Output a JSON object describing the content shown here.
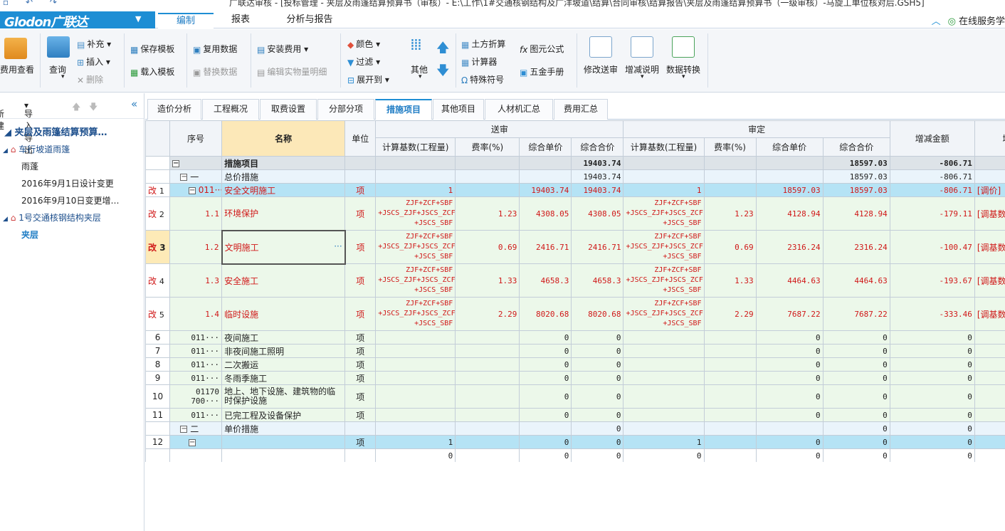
{
  "app": {
    "title": "广联达审核 - [投标管理 - 夹层及雨篷结算预算书（审核）- E:\\工作\\1#交通核钢结构及广洋坡道\\结算\\合同审核\\结算报告\\夹层及雨篷结算预算书（一级审核）-马旋工单位核对后.GSH5]",
    "logo": "Glodon广联达",
    "online": "在线服务学"
  },
  "menu": {
    "tabs": [
      "编制",
      "报表",
      "分析与报告"
    ]
  },
  "ribbon": {
    "fee_view": "费用查看",
    "query": "查询",
    "supplement": "补充",
    "insert": "插入",
    "delete": "删除",
    "save_template": "保存模板",
    "load_template": "载入模板",
    "reuse_data": "复用数据",
    "replace_data": "替换数据",
    "install_fee": "安装费用",
    "edit_detail": "编辑实物量明细",
    "color": "颜色",
    "filter": "过滤",
    "expand_to": "展开到",
    "other": "其他",
    "earth_calc": "土方折算",
    "calculator": "计算器",
    "special_symbol": "特殊符号",
    "formula": "图元公式",
    "hardware_manual": "五金手册",
    "modify_submit": "修改送审",
    "change_note": "增减说明",
    "data_convert": "数据转换"
  },
  "left_panel": {
    "new": "新建",
    "import_export": "导入导出",
    "tree": [
      "夹层及雨篷结算预算…",
      "车行坡道雨篷",
      "雨蓬",
      "2016年9月1日设计变更",
      "2016年9月10日变更增…",
      "1号交通核钢结构夹层",
      "夹层"
    ]
  },
  "function_tabs": [
    "造价分析",
    "工程概况",
    "取费设置",
    "分部分项",
    "措施项目",
    "其他项目",
    "人材机汇总",
    "费用汇总"
  ],
  "grid": {
    "headers": {
      "seq": "序号",
      "name": "名称",
      "unit": "单位",
      "submit": "送审",
      "review": "审定",
      "calc_base": "计算基数(工程量)",
      "rate": "费率(%)",
      "unit_price": "综合单价",
      "total_price": "综合合价",
      "change": "增减金额",
      "extra": "增"
    },
    "rows": [
      {
        "mark": "",
        "no": "",
        "seq": "",
        "name": "措施项目",
        "unit": "",
        "s_base": "",
        "s_rate": "",
        "s_up": "",
        "s_tp": "19403.74",
        "r_base": "",
        "r_rate": "",
        "r_up": "",
        "r_tp": "18597.03",
        "change": "-806.71",
        "extra": ""
      },
      {
        "mark": "",
        "no": "",
        "seq": "一",
        "name": "总价措施",
        "unit": "",
        "s_base": "",
        "s_rate": "",
        "s_up": "",
        "s_tp": "19403.74",
        "r_base": "",
        "r_rate": "",
        "r_up": "",
        "r_tp": "18597.03",
        "change": "-806.71",
        "extra": ""
      },
      {
        "mark": "改",
        "no": "1",
        "seq": "011···",
        "name": "安全文明施工",
        "unit": "项",
        "s_base": "1",
        "s_rate": "",
        "s_up": "19403.74",
        "s_tp": "19403.74",
        "r_base": "1",
        "r_rate": "",
        "r_up": "18597.03",
        "r_tp": "18597.03",
        "change": "-806.71",
        "extra": "[调价]"
      },
      {
        "mark": "改",
        "no": "2",
        "seq": "1.1",
        "name": "环境保护",
        "unit": "项",
        "s_base": "ZJF+ZCF+SBF +JSCS_ZJF+JSCS_ZCF +JSCS_SBF",
        "s_rate": "1.23",
        "s_up": "4308.05",
        "s_tp": "4308.05",
        "r_base": "ZJF+ZCF+SBF +JSCS_ZJF+JSCS_ZCF +JSCS_SBF",
        "r_rate": "1.23",
        "r_up": "4128.94",
        "r_tp": "4128.94",
        "change": "-179.11",
        "extra": "[调基数"
      },
      {
        "mark": "改",
        "no": "3",
        "seq": "1.2",
        "name": "文明施工",
        "unit": "项",
        "s_base": "ZJF+ZCF+SBF +JSCS_ZJF+JSCS_ZCF +JSCS_SBF",
        "s_rate": "0.69",
        "s_up": "2416.71",
        "s_tp": "2416.71",
        "r_base": "ZJF+ZCF+SBF +JSCS_ZJF+JSCS_ZCF +JSCS_SBF",
        "r_rate": "0.69",
        "r_up": "2316.24",
        "r_tp": "2316.24",
        "change": "-100.47",
        "extra": "[调基数"
      },
      {
        "mark": "改",
        "no": "4",
        "seq": "1.3",
        "name": "安全施工",
        "unit": "项",
        "s_base": "ZJF+ZCF+SBF +JSCS_ZJF+JSCS_ZCF +JSCS_SBF",
        "s_rate": "1.33",
        "s_up": "4658.3",
        "s_tp": "4658.3",
        "r_base": "ZJF+ZCF+SBF +JSCS_ZJF+JSCS_ZCF +JSCS_SBF",
        "r_rate": "1.33",
        "r_up": "4464.63",
        "r_tp": "4464.63",
        "change": "-193.67",
        "extra": "[调基数"
      },
      {
        "mark": "改",
        "no": "5",
        "seq": "1.4",
        "name": "临时设施",
        "unit": "项",
        "s_base": "ZJF+ZCF+SBF +JSCS_ZJF+JSCS_ZCF +JSCS_SBF",
        "s_rate": "2.29",
        "s_up": "8020.68",
        "s_tp": "8020.68",
        "r_base": "ZJF+ZCF+SBF +JSCS_ZJF+JSCS_ZCF +JSCS_SBF",
        "r_rate": "2.29",
        "r_up": "7687.22",
        "r_tp": "7687.22",
        "change": "-333.46",
        "extra": "[调基数"
      },
      {
        "mark": "",
        "no": "6",
        "seq": "011···",
        "name": "夜间施工",
        "unit": "项",
        "s_base": "",
        "s_rate": "",
        "s_up": "0",
        "s_tp": "0",
        "r_base": "",
        "r_rate": "",
        "r_up": "0",
        "r_tp": "0",
        "change": "0",
        "extra": ""
      },
      {
        "mark": "",
        "no": "7",
        "seq": "011···",
        "name": "非夜间施工照明",
        "unit": "项",
        "s_base": "",
        "s_rate": "",
        "s_up": "0",
        "s_tp": "0",
        "r_base": "",
        "r_rate": "",
        "r_up": "0",
        "r_tp": "0",
        "change": "0",
        "extra": ""
      },
      {
        "mark": "",
        "no": "8",
        "seq": "011···",
        "name": "二次搬运",
        "unit": "项",
        "s_base": "",
        "s_rate": "",
        "s_up": "0",
        "s_tp": "0",
        "r_base": "",
        "r_rate": "",
        "r_up": "0",
        "r_tp": "0",
        "change": "0",
        "extra": ""
      },
      {
        "mark": "",
        "no": "9",
        "seq": "011···",
        "name": "冬雨季施工",
        "unit": "项",
        "s_base": "",
        "s_rate": "",
        "s_up": "0",
        "s_tp": "0",
        "r_base": "",
        "r_rate": "",
        "r_up": "0",
        "r_tp": "0",
        "change": "0",
        "extra": ""
      },
      {
        "mark": "",
        "no": "10",
        "seq": "01170 700···",
        "name": "地上、地下设施、建筑物的临时保护设施",
        "unit": "项",
        "s_base": "",
        "s_rate": "",
        "s_up": "0",
        "s_tp": "0",
        "r_base": "",
        "r_rate": "",
        "r_up": "0",
        "r_tp": "0",
        "change": "0",
        "extra": ""
      },
      {
        "mark": "",
        "no": "11",
        "seq": "011···",
        "name": "已完工程及设备保护",
        "unit": "项",
        "s_base": "",
        "s_rate": "",
        "s_up": "0",
        "s_tp": "0",
        "r_base": "",
        "r_rate": "",
        "r_up": "0",
        "r_tp": "0",
        "change": "0",
        "extra": ""
      },
      {
        "mark": "",
        "no": "",
        "seq": "二",
        "name": "单价措施",
        "unit": "",
        "s_base": "",
        "s_rate": "",
        "s_up": "",
        "s_tp": "0",
        "r_base": "",
        "r_rate": "",
        "r_up": "",
        "r_tp": "0",
        "change": "0",
        "extra": ""
      },
      {
        "mark": "",
        "no": "12",
        "seq": "",
        "name": "",
        "unit": "项",
        "s_base": "1",
        "s_rate": "",
        "s_up": "0",
        "s_tp": "0",
        "r_base": "1",
        "r_rate": "",
        "r_up": "0",
        "r_tp": "0",
        "change": "0",
        "extra": ""
      },
      {
        "mark": "",
        "no": "",
        "seq": "",
        "name": "",
        "unit": "",
        "s_base": "0",
        "s_rate": "",
        "s_up": "0",
        "s_tp": "0",
        "r_base": "0",
        "r_rate": "",
        "r_up": "0",
        "r_tp": "0",
        "change": "0",
        "extra": ""
      }
    ]
  }
}
